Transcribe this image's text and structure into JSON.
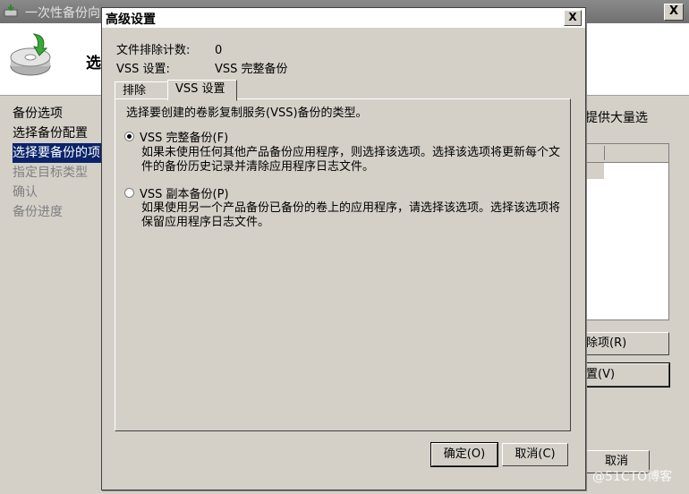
{
  "background_window": {
    "title": "一次性备份向",
    "close_label": "X",
    "header_title": "选",
    "steps": [
      "备份选项",
      "选择备份配置",
      "选择要备份的项",
      "指定目标类型",
      "确认",
      "备份进度"
    ],
    "description_fragment": "提供大量选",
    "button1_label": "除项(R)",
    "button2_label": "置(V)",
    "button3_label": "取消"
  },
  "dialog": {
    "title": "高级设置",
    "close_label": "X",
    "exclusion_count_label": "文件排除计数:",
    "exclusion_count_value": "0",
    "vss_setting_label": "VSS 设置:",
    "vss_setting_value": "VSS 完整备份",
    "tabs": [
      {
        "label": "排除",
        "active": false
      },
      {
        "label": "VSS 设置",
        "active": true
      }
    ],
    "panel": {
      "intro": "选择要创建的卷影复制服务(VSS)备份的类型。",
      "options": [
        {
          "label": "VSS 完整备份(F)",
          "selected": true,
          "description": "如果未使用任何其他产品备份应用程序，则选择该选项。选择该选项将更新每个文件的备份历史记录并清除应用程序日志文件。"
        },
        {
          "label": "VSS 副本备份(P)",
          "selected": false,
          "description": "如果使用另一个产品备份已备份的卷上的应用程序，请选择该选项。选择该选项将保留应用程序日志文件。"
        }
      ]
    },
    "ok_label": "确定(O)",
    "cancel_label": "取消(C)"
  },
  "watermark": "@51CTO博客",
  "colors": {
    "selection": "#0a246a",
    "face": "#d4d0c8",
    "disabled_text": "#808080"
  },
  "icons": {
    "app": "backup-app-icon",
    "header": "disk-backup-icon"
  }
}
